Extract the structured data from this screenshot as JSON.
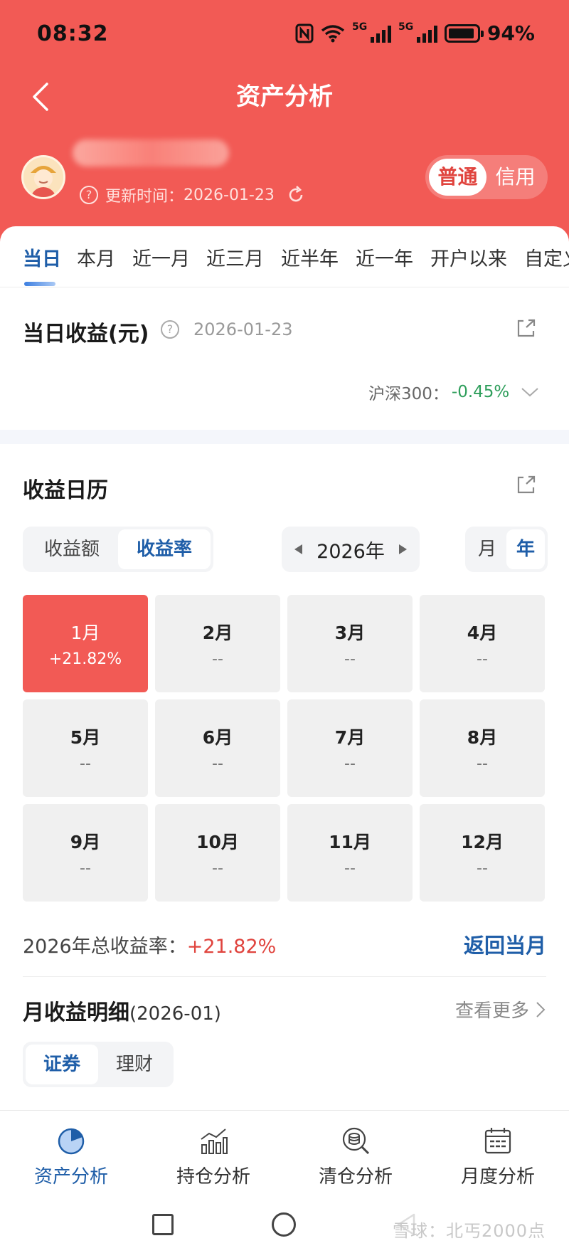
{
  "status_bar": {
    "time": "08:32",
    "battery": "94%",
    "signal_label": "5G",
    "signal_label_2": "5G"
  },
  "nav": {
    "title": "资产分析"
  },
  "account": {
    "update_label": "更新时间：",
    "update_date": "2026-01-23",
    "toggle": [
      {
        "label": "普通",
        "active": true
      },
      {
        "label": "信用",
        "active": false
      }
    ]
  },
  "range_tabs": [
    "当日",
    "本月",
    "近一月",
    "近三月",
    "近半年",
    "近一年",
    "开户以来",
    "自定义"
  ],
  "daily": {
    "title": "当日收益(元)",
    "date": "2026-01-23",
    "benchmark_label": "沪深300：",
    "benchmark_value": "-0.45%"
  },
  "calendar": {
    "title": "收益日历",
    "value_toggle": [
      {
        "label": "收益额",
        "active": false
      },
      {
        "label": "收益率",
        "active": true
      }
    ],
    "year": "2026年",
    "period_toggle": [
      {
        "label": "月",
        "active": false
      },
      {
        "label": "年",
        "active": true
      }
    ],
    "months": [
      {
        "name": "1月",
        "value": "+21.82%",
        "active": true
      },
      {
        "name": "2月",
        "value": "--"
      },
      {
        "name": "3月",
        "value": "--"
      },
      {
        "name": "4月",
        "value": "--"
      },
      {
        "name": "5月",
        "value": "--"
      },
      {
        "name": "6月",
        "value": "--"
      },
      {
        "name": "7月",
        "value": "--"
      },
      {
        "name": "8月",
        "value": "--"
      },
      {
        "name": "9月",
        "value": "--"
      },
      {
        "name": "10月",
        "value": "--"
      },
      {
        "name": "11月",
        "value": "--"
      },
      {
        "name": "12月",
        "value": "--"
      }
    ],
    "total_label": "2026年总收益率：",
    "total_value": "+21.82%",
    "back_label": "返回当月"
  },
  "monthly_detail": {
    "title": "月收益明细",
    "period": "(2026-01)",
    "more_label": "查看更多",
    "tabs": [
      {
        "label": "证券",
        "active": true
      },
      {
        "label": "理财",
        "active": false
      }
    ]
  },
  "bottom_nav": [
    {
      "label": "资产分析",
      "icon": "pie-chart-icon",
      "active": true
    },
    {
      "label": "持仓分析",
      "icon": "bar-trend-icon",
      "active": false
    },
    {
      "label": "清仓分析",
      "icon": "coin-search-icon",
      "active": false
    },
    {
      "label": "月度分析",
      "icon": "calendar-icon",
      "active": false
    }
  ],
  "watermark": "雪球：北丐2000点",
  "colors": {
    "brand_red": "#f25a55",
    "accent_blue": "#1f5ea8",
    "loss_green": "#2e9e5b",
    "gain_red": "#e0443e"
  }
}
